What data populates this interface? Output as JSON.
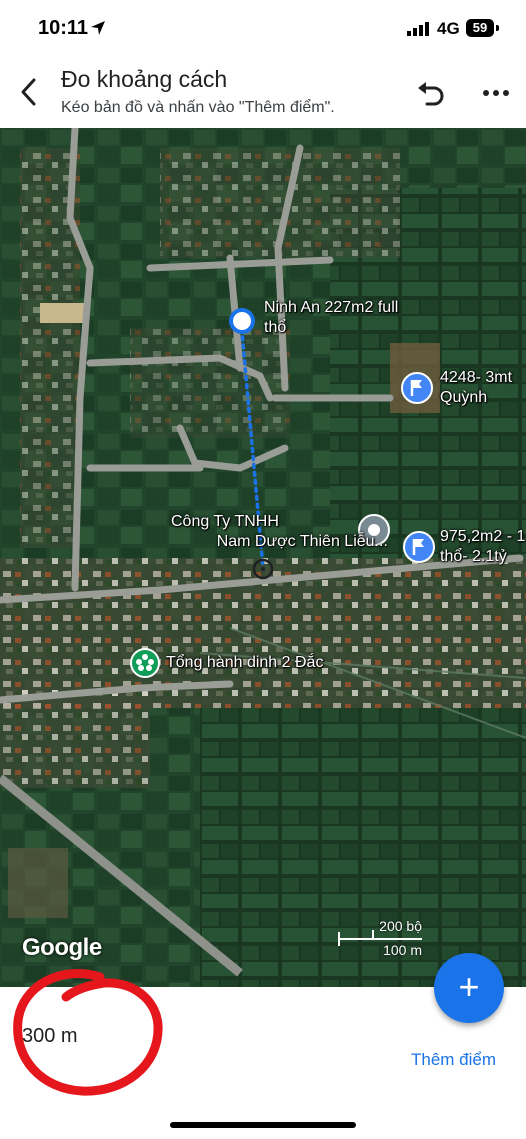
{
  "status_bar": {
    "time": "10:11",
    "network": "4G",
    "battery": "59"
  },
  "header": {
    "title": "Đo khoảng cách",
    "subtitle": "Kéo bản đồ và nhấn vào \"Thêm điểm\"."
  },
  "map": {
    "places": [
      {
        "line1": "Ninh An 227m2 full",
        "line2": "thổ"
      },
      {
        "line1": "4248- 3mt",
        "line2": "Quỳnh"
      },
      {
        "line1": "Công Ty TNHH",
        "line2": "Nam Dược Thiên Liễu..."
      },
      {
        "line1": "975,2m2 - 1",
        "line2": "thổ- 2.1tỷ"
      },
      {
        "line1": "Tổng hành dinh 2 Đắc"
      }
    ],
    "google_label": "Google",
    "scale": {
      "imperial": "200 bộ",
      "metric": "100 m"
    }
  },
  "bottom": {
    "distance": "300 m",
    "add_point": "Thêm điểm",
    "fab_symbol": "+"
  },
  "colors": {
    "accent": "#1a73e8",
    "annotation": "#e5171c"
  }
}
